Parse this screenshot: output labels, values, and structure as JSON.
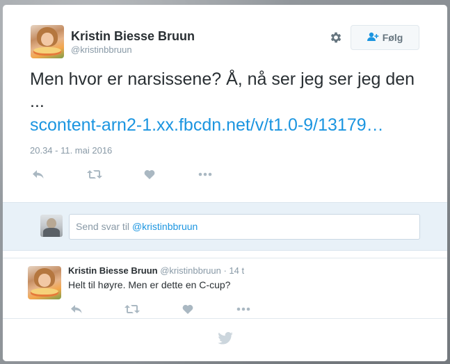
{
  "tweet": {
    "author_name": "Kristin Biesse Bruun",
    "author_handle": "@kristinbbruun",
    "follow_label": "Følg",
    "text": "Men hvor er narsissene? Å, nå ser jeg ser jeg den ...",
    "link": "scontent-arn2-1.xx.fbcdn.net/v/t1.0-9/13179…",
    "timestamp": "20.34 - 11. mai 2016"
  },
  "reply_box": {
    "prefix": "Send svar til ",
    "mention": "@kristinbbruun"
  },
  "reply": {
    "author_name": "Kristin Biesse Bruun",
    "author_handle": "@kristinbbruun",
    "separator": " · ",
    "age": "14 t",
    "text": "Helt til høyre. Men er dette en C-cup?"
  },
  "icons": {
    "gear": "gear-icon",
    "follow": "add-user-icon",
    "reply": "reply-icon",
    "retweet": "retweet-icon",
    "like": "heart-icon",
    "more": "more-icon",
    "footer": "twitter-bird-icon"
  },
  "colors": {
    "link": "#1b95e0",
    "icon": "#aab8c2",
    "reply_bar": "#e8f1f8",
    "text": "#292f33",
    "muted": "#8899a6"
  }
}
